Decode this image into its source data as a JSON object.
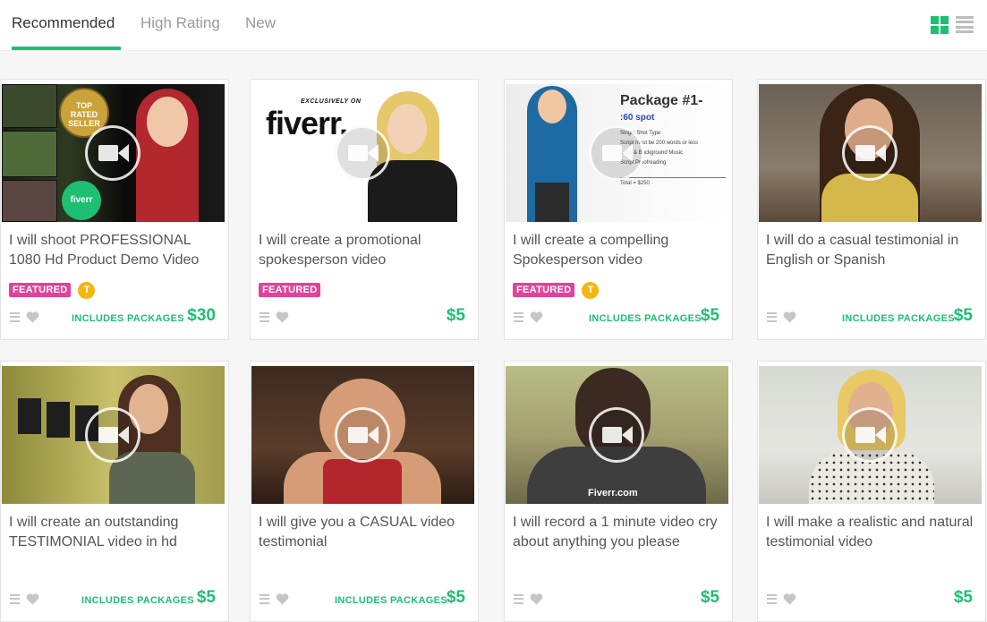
{
  "tabs": [
    {
      "label": "Recommended",
      "active": true
    },
    {
      "label": "High Rating",
      "active": false
    },
    {
      "label": "New",
      "active": false
    }
  ],
  "view_toggle": {
    "active": "grid",
    "options": [
      "grid",
      "list"
    ]
  },
  "colors": {
    "accent": "#1dbf73",
    "featured": "#e1429b",
    "top_rated_badge": "#f6b60d"
  },
  "gigs": [
    {
      "title": "I will shoot PROFESSIONAL 1080 Hd Product Demo Video",
      "featured": "FEATURED",
      "top_rated": "T",
      "packages": "INCLUDES PACKAGES",
      "price": "$30",
      "thumb_text": {
        "badge1": "TOP",
        "badge2": "RATED",
        "badge3": "SELLER",
        "logo": "fiverr"
      }
    },
    {
      "title": "I will create a promotional spokesperson video",
      "featured": "FEATURED",
      "top_rated": "",
      "packages": "",
      "price": "$5",
      "thumb_text": {
        "tag": "EXCLUSIVELY ON",
        "logo": "fiverr."
      }
    },
    {
      "title": "I will create a compelling Spokesperson video",
      "featured": "FEATURED",
      "top_rated": "T",
      "packages": "INCLUDES PACKAGES",
      "price": "$5",
      "thumb_text": {
        "heading": "Package #1-",
        "sub": ":60 spot",
        "l1": "Single Shot Type",
        "l2": "Script must be 200 words or less",
        "l3": "Logo & Background Music",
        "l4": "Script Proofreading",
        "total": "Total = $250"
      }
    },
    {
      "title": "I will do a casual testimonial in English or Spanish",
      "featured": "",
      "top_rated": "",
      "packages": "INCLUDES PACKAGES",
      "price": "$5",
      "thumb_text": {}
    },
    {
      "title": "I will create an outstanding TESTIMONIAL video in hd",
      "featured": "",
      "top_rated": "",
      "packages": "INCLUDES PACKAGES",
      "price": "$5",
      "thumb_text": {}
    },
    {
      "title": "I will give you a CASUAL video testimonial",
      "featured": "",
      "top_rated": "",
      "packages": "INCLUDES PACKAGES",
      "price": "$5",
      "thumb_text": {}
    },
    {
      "title": "I will record a 1 minute video cry about anything you please",
      "featured": "",
      "top_rated": "",
      "packages": "",
      "price": "$5",
      "thumb_text": {
        "watermark": "Fiverr.com"
      }
    },
    {
      "title": "I will make a realistic and natural testimonial video",
      "featured": "",
      "top_rated": "",
      "packages": "",
      "price": "$5",
      "thumb_text": {}
    }
  ]
}
